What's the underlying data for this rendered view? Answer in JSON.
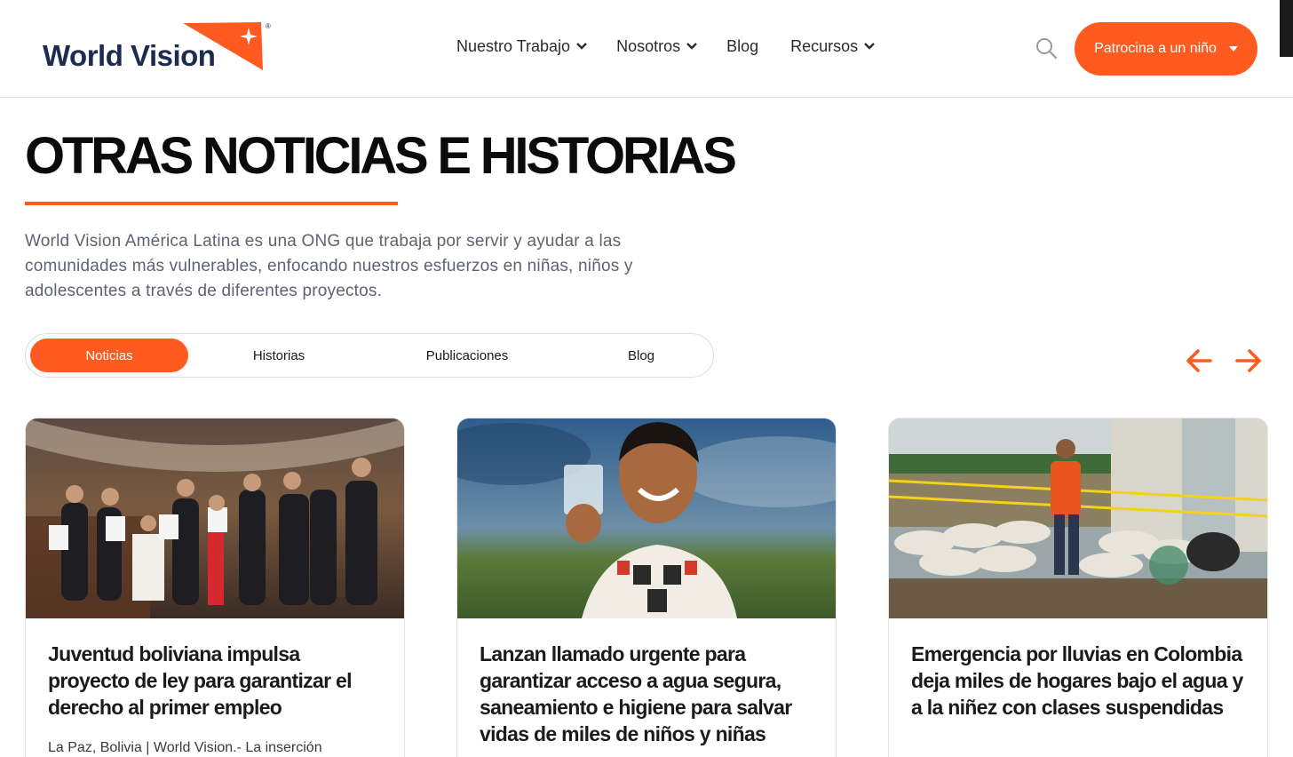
{
  "brand": {
    "name": "World Vision",
    "registered_mark": "®",
    "accent_color": "#ff5a1f",
    "navy_color": "#1d2b4f"
  },
  "nav": {
    "items": [
      {
        "label": "Nuestro Trabajo",
        "has_dropdown": true
      },
      {
        "label": "Nosotros",
        "has_dropdown": true
      },
      {
        "label": "Blog",
        "has_dropdown": false
      },
      {
        "label": "Recursos",
        "has_dropdown": true
      }
    ],
    "search_icon": "search-icon",
    "cta_label": "Patrocina a un niño"
  },
  "hero": {
    "title": "OTRAS NOTICIAS E HISTORIAS",
    "intro": "World Vision América Latina es una ONG que trabaja por servir y ayudar a las comunidades más vulnerables, enfocando nuestros esfuerzos en niñas, niños y adolescentes a través de diferentes proyectos."
  },
  "tabs": {
    "items": [
      {
        "label": "Noticias",
        "active": true
      },
      {
        "label": "Historias",
        "active": false
      },
      {
        "label": "Publicaciones",
        "active": false
      },
      {
        "label": "Blog",
        "active": false
      }
    ]
  },
  "carousel": {
    "prev_icon": "arrow-left-icon",
    "next_icon": "arrow-right-icon"
  },
  "cards": [
    {
      "image": "photo-youth-holding-certificates",
      "title": "Juventud boliviana impulsa proyecto de ley para garantizar el derecho al primer empleo",
      "excerpt": "La Paz, Bolivia | World Vision.-  La inserción"
    },
    {
      "image": "photo-boy-holding-water-glass",
      "title": "Lanzan llamado urgente para garantizar acceso a agua segura, saneamiento e higiene para salvar vidas de miles de niños y niñas",
      "excerpt": ""
    },
    {
      "image": "photo-flood-sandbags-worker",
      "title": "Emergencia por lluvias en Colombia deja miles de hogares bajo el agua y a la niñez con clases suspendidas",
      "excerpt": ""
    }
  ]
}
